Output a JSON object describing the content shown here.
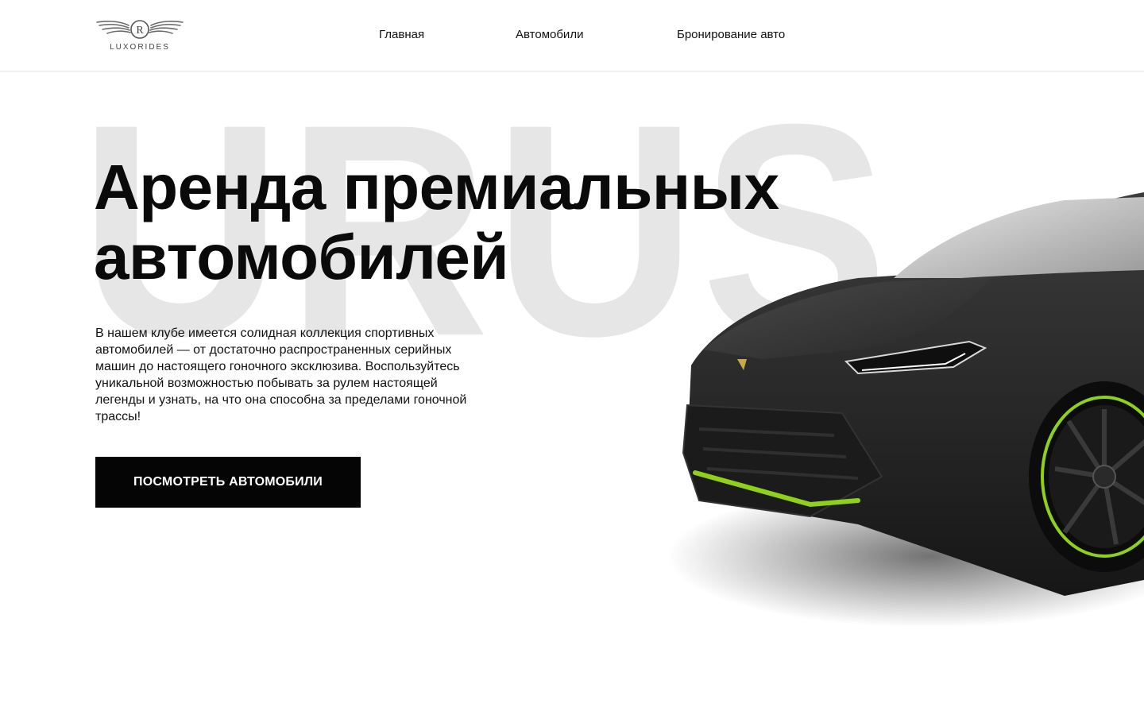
{
  "brand": {
    "name": "LUXORIDES",
    "monogram": "R"
  },
  "nav": {
    "items": [
      {
        "label": "Главная"
      },
      {
        "label": "Автомобили"
      },
      {
        "label": "Бронирование авто"
      }
    ]
  },
  "hero": {
    "watermark": "URUS",
    "title_line1": "Аренда премиальных",
    "title_line2": "автомобилей",
    "description": "В нашем клубе имеется солидная коллекция спортивных автомобилей — от достаточно распространенных серийных машин до настоящего гоночного эксклюзива. Воспользуйтесь уникальной возможностью побывать за рулем настоящей легенды и узнать, на что она способна за пределами гоночной трассы!",
    "cta_label": "ПОСМОТРЕТЬ АВТОМОБИЛИ"
  },
  "colors": {
    "background": "#ffffff",
    "text": "#0a0a0a",
    "watermark": "#e6e6e6",
    "button": "#050505",
    "button_text": "#ffffff",
    "car_body": "#2a2a2a",
    "car_accent": "#8fd11a"
  }
}
